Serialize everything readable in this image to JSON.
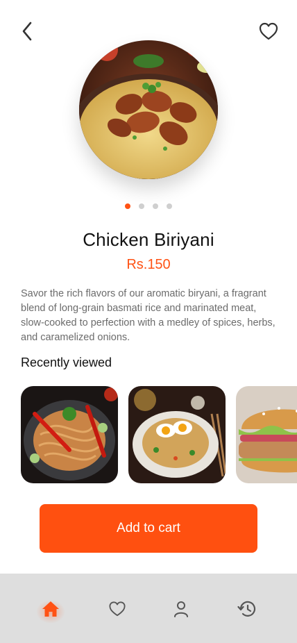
{
  "header": {
    "back_icon": "chevron-left-icon",
    "favorite_icon": "heart-outline-icon"
  },
  "product": {
    "name": "Chicken Biriyani",
    "price": "Rs.150",
    "description": "Savor the rich flavors of our aromatic biryani, a fragrant blend of long-grain basmati rice and marinated meat, slow-cooked to perfection with a medley of spices, herbs, and caramelized onions.",
    "image_icon": "chicken-biriyani-image",
    "carousel": {
      "total": 4,
      "active_index": 0
    }
  },
  "recently_viewed": {
    "title": "Recently viewed",
    "items": [
      {
        "image": "spicy-noodles-image"
      },
      {
        "image": "fried-rice-with-eggs-image"
      },
      {
        "image": "burger-image"
      }
    ]
  },
  "cta": {
    "label": "Add to cart"
  },
  "colors": {
    "accent": "#ff5214",
    "nav_bg": "#dedede",
    "text_muted": "#6b6b6b",
    "icon_gray": "#555555"
  },
  "navbar": {
    "items": [
      {
        "icon": "home-icon",
        "active": true
      },
      {
        "icon": "heart-icon",
        "active": false
      },
      {
        "icon": "user-icon",
        "active": false
      },
      {
        "icon": "history-icon",
        "active": false
      }
    ]
  }
}
